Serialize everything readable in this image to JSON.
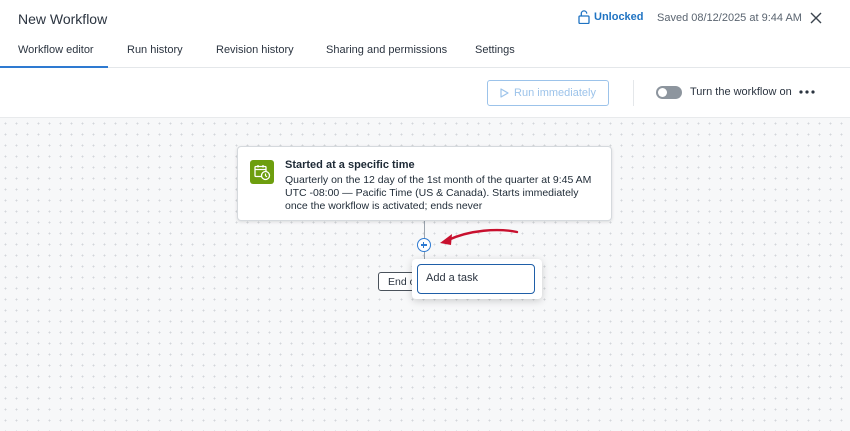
{
  "header": {
    "title": "New Workflow",
    "lock_label": "Unlocked",
    "lock_icon": "padlock-open-icon",
    "saved_text": "Saved 08/12/2025 at 9:44 AM",
    "close_icon": "close-icon"
  },
  "tabs": [
    {
      "label": "Workflow editor",
      "active": true
    },
    {
      "label": "Run history"
    },
    {
      "label": "Revision history"
    },
    {
      "label": "Sharing and permissions"
    },
    {
      "label": "Settings"
    }
  ],
  "toolbar": {
    "run_label": "Run immediately",
    "run_enabled": false,
    "toggle_label": "Turn the workflow on",
    "toggle_on": false
  },
  "trigger": {
    "title": "Started at a specific time",
    "description": "Quarterly on the 12 day of the 1st month of the quarter at 9:45 AM UTC -08:00 — Pacific Time (US & Canada). Starts immediately once the workflow is activated; ends never",
    "icon": "calendar-clock-icon",
    "icon_color": "#6d9e0e"
  },
  "end_button_label": "End of",
  "menu": {
    "items": [
      "Add a task"
    ]
  },
  "colors": {
    "accent": "#2e7ad1",
    "annotation_arrow": "#c8102e"
  }
}
